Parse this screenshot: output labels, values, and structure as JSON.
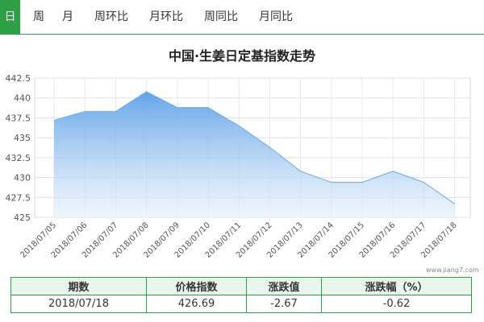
{
  "tabs": [
    {
      "label": "日",
      "active": true
    },
    {
      "label": "周",
      "active": false
    },
    {
      "label": "月",
      "active": false
    },
    {
      "label": "周环比",
      "active": false
    },
    {
      "label": "月环比",
      "active": false
    },
    {
      "label": "周同比",
      "active": false
    },
    {
      "label": "月同比",
      "active": false
    }
  ],
  "watermark": "www.jiang7.com",
  "colors": {
    "accent": "#2e9e47",
    "line": "#7fb3e6",
    "area_top": "#5b9fe6",
    "area_bottom": "#e6f0fb"
  },
  "chart_data": {
    "type": "area",
    "title": "中国·生姜日定基指数走势",
    "xlabel": "",
    "ylabel": "",
    "categories": [
      "2018/07/05",
      "2018/07/06",
      "2018/07/07",
      "2018/07/08",
      "2018/07/09",
      "2018/07/10",
      "2018/07/11",
      "2018/07/12",
      "2018/07/13",
      "2018/07/14",
      "2018/07/15",
      "2018/07/16",
      "2018/07/17",
      "2018/07/18"
    ],
    "values": [
      437.2,
      438.3,
      438.3,
      440.8,
      438.8,
      438.8,
      436.5,
      433.8,
      430.8,
      429.4,
      429.4,
      430.8,
      429.4,
      426.69
    ],
    "ylim": [
      425,
      442.5
    ],
    "yticks": [
      "425",
      "427.5",
      "430",
      "432.5",
      "435",
      "437.5",
      "440",
      "442.5"
    ],
    "grid": true,
    "legend": "none"
  },
  "summary": {
    "headers": [
      "期数",
      "价格指数",
      "涨跌值",
      "涨跌幅（%）"
    ],
    "row": [
      "2018/07/18",
      "426.69",
      "-2.67",
      "-0.62"
    ]
  }
}
